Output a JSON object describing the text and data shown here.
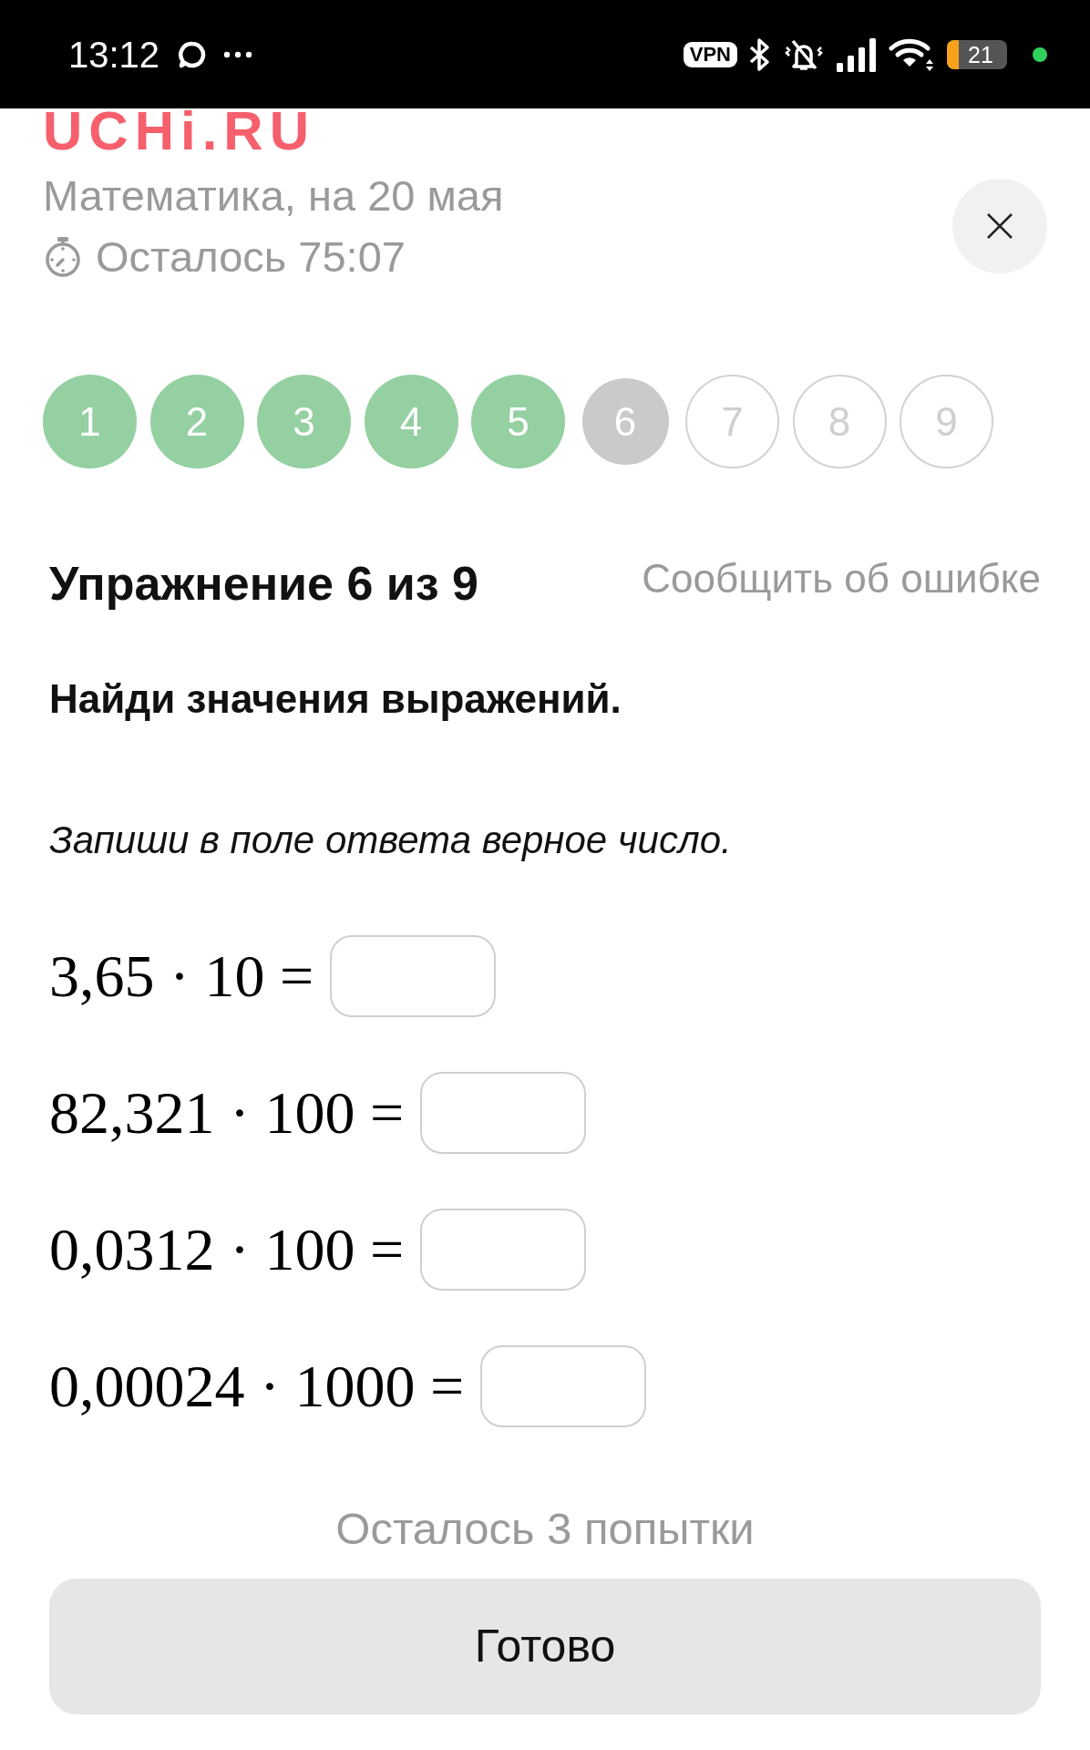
{
  "status_bar": {
    "time": "13:12",
    "vpn_label": "VPN",
    "battery": "21"
  },
  "header": {
    "logo": "UCHi.RU",
    "subject": "Математика, на 20 мая",
    "timer": "Осталось 75:07"
  },
  "steps": [
    {
      "label": "1",
      "done": true,
      "selected": false
    },
    {
      "label": "2",
      "done": true,
      "selected": false
    },
    {
      "label": "3",
      "done": true,
      "selected": false
    },
    {
      "label": "4",
      "done": true,
      "selected": false
    },
    {
      "label": "5",
      "done": true,
      "selected": false
    },
    {
      "label": "6",
      "done": false,
      "selected": true
    },
    {
      "label": "7",
      "done": false,
      "selected": false
    },
    {
      "label": "8",
      "done": false,
      "selected": false
    },
    {
      "label": "9",
      "done": false,
      "selected": false
    }
  ],
  "exercise": {
    "title": "Упражнение 6 из 9",
    "report_link": "Сообщить об ошибке",
    "task": "Найди значения выражений.",
    "instruction": "Запиши в поле ответа верное число.",
    "expressions": [
      {
        "expression": "3,65 · 10 ="
      },
      {
        "expression": "82,321 · 100 ="
      },
      {
        "expression": "0,0312 · 100 ="
      },
      {
        "expression": "0,00024 · 1000 ="
      }
    ]
  },
  "footer": {
    "attempts": "Осталось 3 попытки",
    "submit_button": "Готово"
  }
}
